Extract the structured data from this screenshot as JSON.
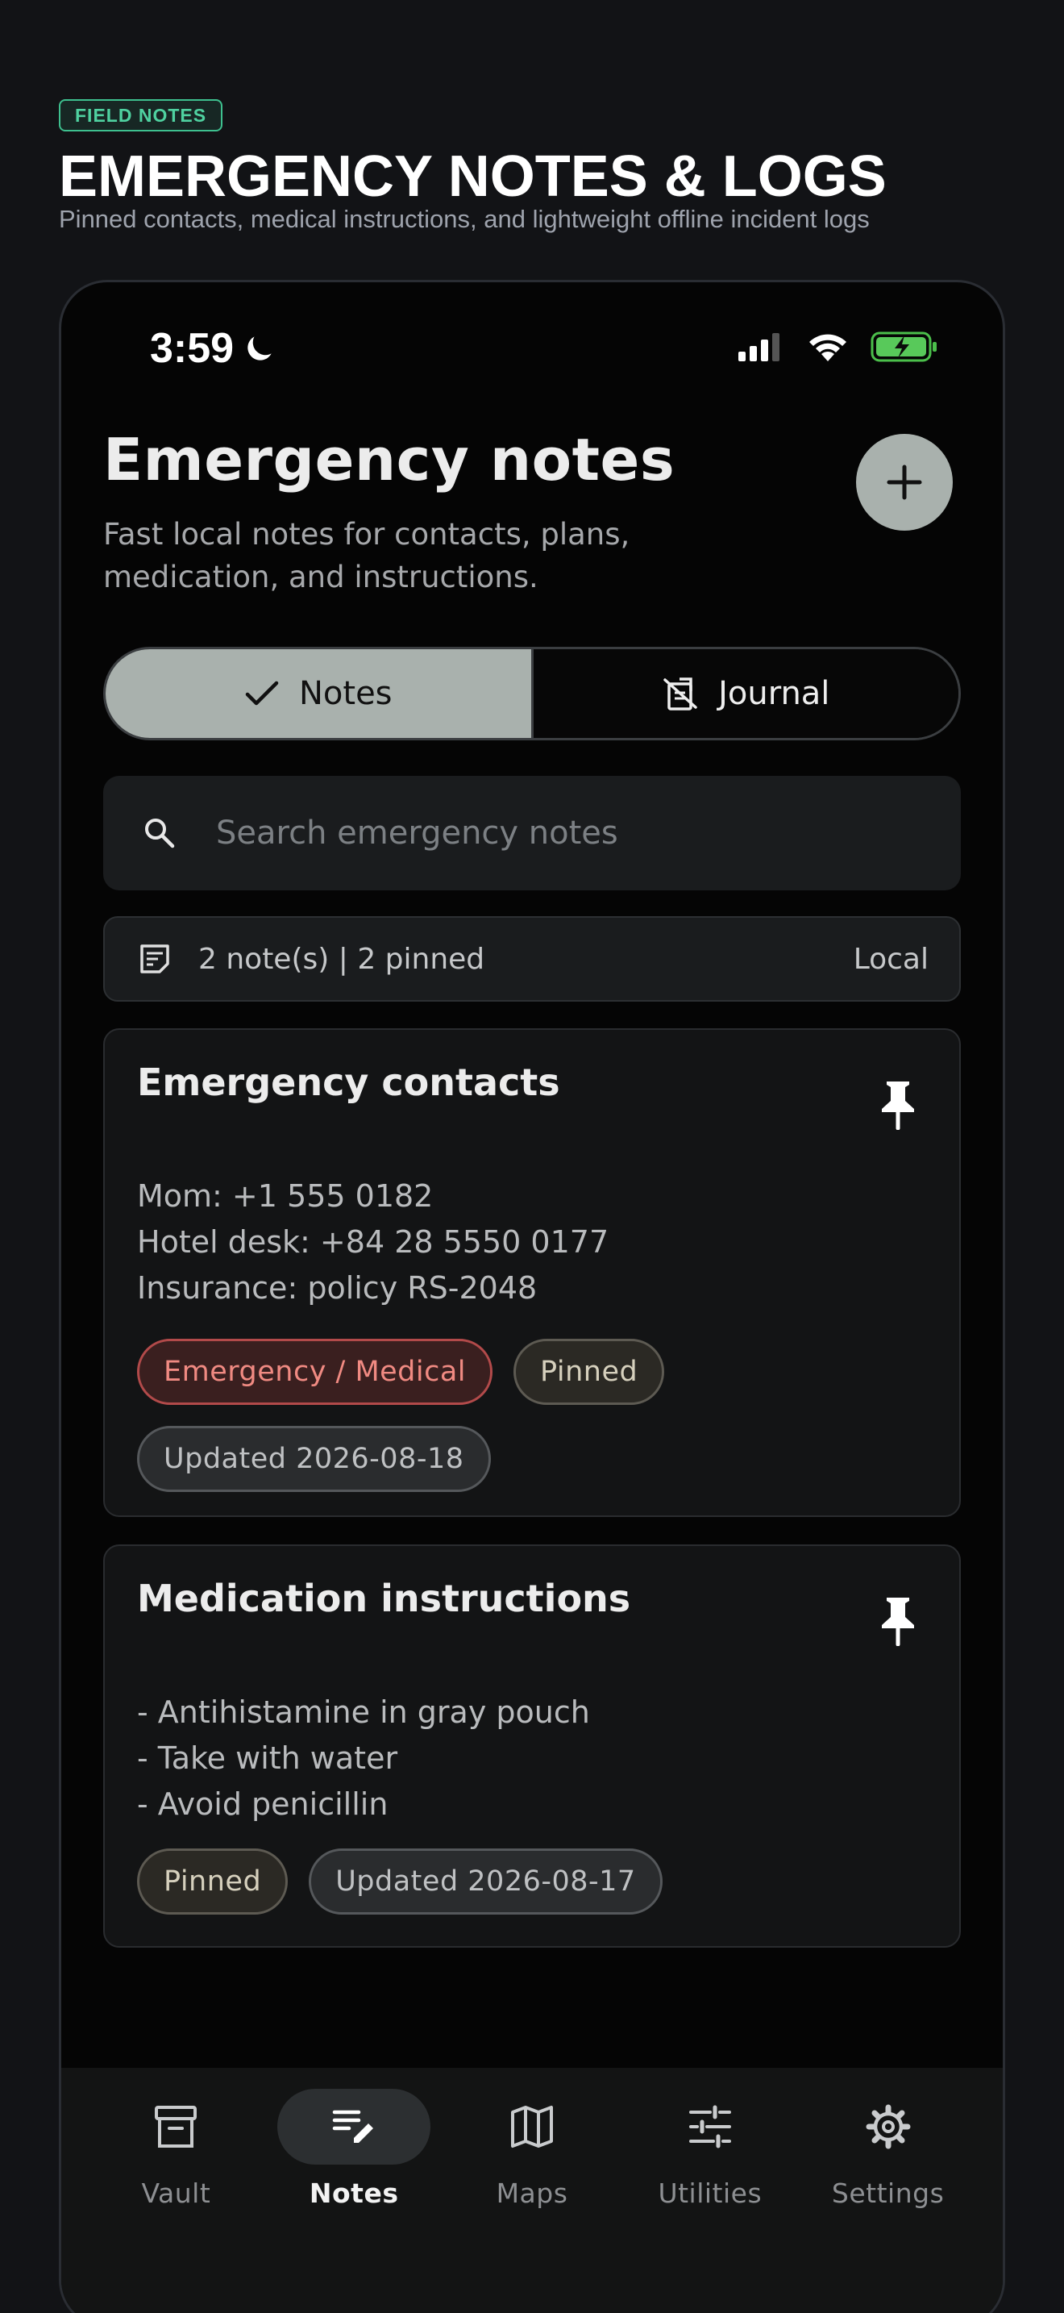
{
  "page": {
    "badge": "FIELD NOTES",
    "title": "EMERGENCY NOTES & LOGS",
    "subtitle": "Pinned contacts, medical instructions, and lightweight offline incident logs"
  },
  "status_bar": {
    "time": "3:59",
    "icons": [
      "moon-icon",
      "signal-icon",
      "wifi-icon",
      "battery-charging-icon"
    ]
  },
  "header": {
    "title": "Emergency notes",
    "subtitle": "Fast local notes for contacts, plans, medication, and instructions.",
    "add_icon": "plus-icon"
  },
  "segment": {
    "notes_label": "Notes",
    "journal_label": "Journal",
    "active": "Notes"
  },
  "search": {
    "placeholder": "Search emergency notes",
    "value": ""
  },
  "summary": {
    "text": "2 note(s) | 2 pinned",
    "storage": "Local"
  },
  "notes": [
    {
      "title": "Emergency contacts",
      "body": "Mom: +1 555 0182\nHotel desk: +84 28 5550 0177\nInsurance: policy RS-2048",
      "tags": [
        "Emergency / Medical",
        "Pinned"
      ],
      "updated": "Updated 2026-08-18"
    },
    {
      "title": "Medication instructions",
      "body": "- Antihistamine in gray pouch\n- Take with water\n- Avoid penicillin",
      "tags": [
        "Pinned"
      ],
      "updated": "Updated 2026-08-17"
    }
  ],
  "nav": {
    "items": [
      {
        "label": "Vault",
        "icon": "archive-icon"
      },
      {
        "label": "Notes",
        "icon": "notes-edit-icon"
      },
      {
        "label": "Maps",
        "icon": "map-icon"
      },
      {
        "label": "Utilities",
        "icon": "sliders-icon"
      },
      {
        "label": "Settings",
        "icon": "gear-icon"
      }
    ],
    "active": "Notes"
  },
  "colors": {
    "background": "#121316",
    "accent": "#a9b1ad",
    "badge_green": "#4fd1a0",
    "medical_red": "#f08a82"
  }
}
